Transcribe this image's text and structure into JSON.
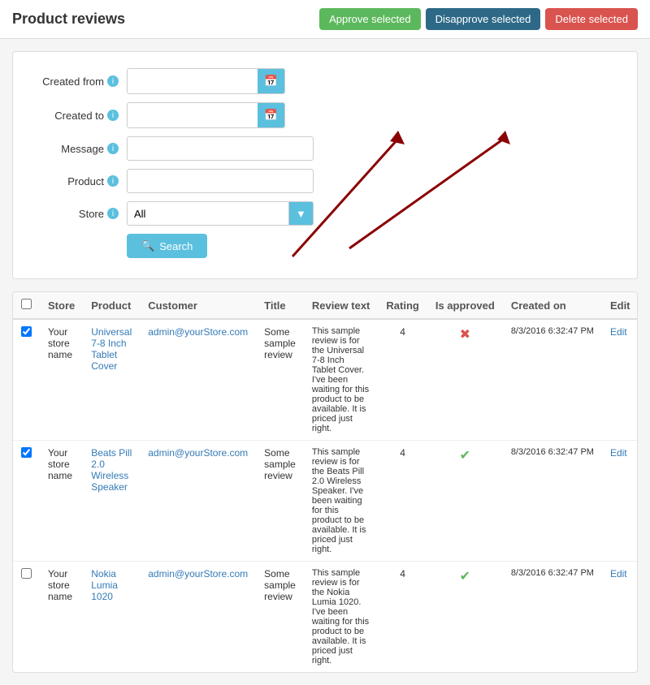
{
  "page": {
    "title": "Product reviews"
  },
  "buttons": {
    "approve": "Approve selected",
    "disapprove": "Disapprove selected",
    "delete": "Delete selected",
    "search": "Search"
  },
  "filters": {
    "created_from_label": "Created from",
    "created_to_label": "Created to",
    "message_label": "Message",
    "product_label": "Product",
    "store_label": "Store",
    "store_options": [
      "All"
    ],
    "store_default": "All"
  },
  "table": {
    "columns": [
      "",
      "Store",
      "Product",
      "Customer",
      "Title",
      "Review text",
      "Rating",
      "Is approved",
      "Created on",
      "Edit"
    ],
    "rows": [
      {
        "checked": true,
        "store": "Your store name",
        "product": "Universal 7-8 Inch Tablet Cover",
        "customer": "admin@yourStore.com",
        "title": "Some sample review",
        "review_text": "This sample review is for the Universal 7-8 Inch Tablet Cover. I've been waiting for this product to be available. It is priced just right.",
        "rating": "4",
        "is_approved": false,
        "created_on": "8/3/2016 6:32:47 PM",
        "edit": "Edit"
      },
      {
        "checked": true,
        "store": "Your store name",
        "product": "Beats Pill 2.0 Wireless Speaker",
        "customer": "admin@yourStore.com",
        "title": "Some sample review",
        "review_text": "This sample review is for the Beats Pill 2.0 Wireless Speaker. I've been waiting for this product to be available. It is priced just right.",
        "rating": "4",
        "is_approved": true,
        "created_on": "8/3/2016 6:32:47 PM",
        "edit": "Edit"
      },
      {
        "checked": false,
        "store": "Your store name",
        "product": "Nokia Lumia 1020",
        "customer": "admin@yourStore.com",
        "title": "Some sample review",
        "review_text": "This sample review is for the Nokia Lumia 1020. I've been waiting for this product to be available. It is priced just right.",
        "rating": "4",
        "is_approved": true,
        "created_on": "8/3/2016 6:32:47 PM",
        "edit": "Edit"
      }
    ]
  },
  "icons": {
    "calendar": "📅",
    "search": "🔍",
    "check": "✔",
    "times": "✖",
    "info": "i",
    "dropdown_arrow": "▼"
  }
}
